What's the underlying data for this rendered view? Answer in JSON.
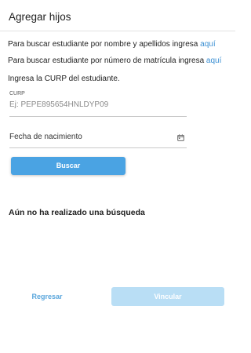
{
  "header": {
    "title": "Agregar hijos"
  },
  "search_by_name": {
    "text": "Para buscar estudiante por nombre y apellidos ingresa ",
    "link": "aquí"
  },
  "search_by_enrollment": {
    "text": "Para buscar estudiante por número de matrícula ingresa ",
    "link": "aquí"
  },
  "curp_prompt": "Ingresa la CURP del estudiante.",
  "curp_field": {
    "label": "CURP",
    "value": "",
    "placeholder": "Ej: PEPE895654HNLDYP09"
  },
  "birthdate_field": {
    "label": "Fecha de nacimiento",
    "icon": "calendar-icon"
  },
  "search_button": {
    "label": "Buscar"
  },
  "results": {
    "empty_message": "Aún no ha realizado una búsqueda"
  },
  "footer": {
    "back_label": "Regresar",
    "link_label": "Vincular"
  },
  "colors": {
    "accent": "#4aa3e3",
    "link": "#3a8fd3",
    "disabled": "#b9def5"
  }
}
